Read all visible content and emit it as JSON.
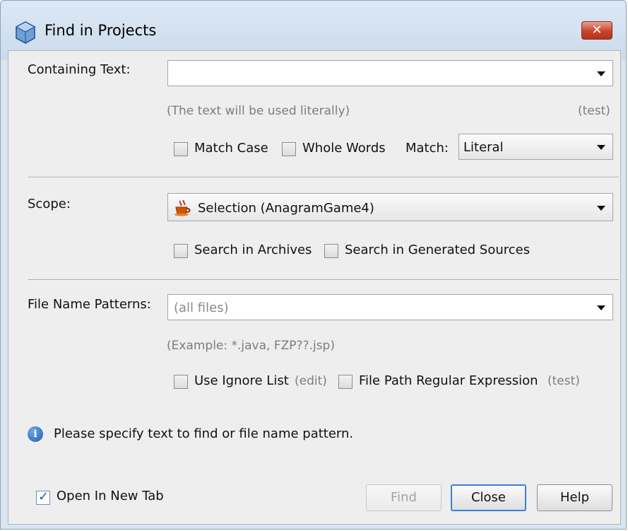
{
  "window": {
    "title": "Find in Projects",
    "close_glyph": "✕"
  },
  "containing_text": {
    "label": "Containing Text:",
    "value": "",
    "hint": "(The text will be used literally)",
    "test_link": "(test)",
    "match_case": {
      "label": "Match Case",
      "checked": false
    },
    "whole_words": {
      "label": "Whole Words",
      "checked": false
    },
    "match_label": "Match:",
    "match_value": "Literal"
  },
  "scope": {
    "label": "Scope:",
    "value": "Selection (AnagramGame4)",
    "icon": "coffee-cup-icon",
    "search_archives": {
      "label": "Search in Archives",
      "checked": false
    },
    "search_generated": {
      "label": "Search in Generated Sources",
      "checked": false
    }
  },
  "file_patterns": {
    "label": "File Name Patterns:",
    "placeholder": "(all files)",
    "example": "(Example: *.java, FZP??.jsp)",
    "ignore_list": {
      "label": "Use Ignore List",
      "checked": false,
      "link": "(edit)"
    },
    "regex": {
      "label": "File Path Regular Expression",
      "checked": false,
      "link": "(test)"
    }
  },
  "status": {
    "icon": "info-icon",
    "message": "Please specify text to find or file name pattern."
  },
  "footer": {
    "open_new_tab": {
      "label": "Open In New Tab",
      "checked": true
    },
    "find_button": "Find",
    "close_button": "Close",
    "help_button": "Help"
  },
  "colors": {
    "title_bar": "#cbdbec",
    "client_bg": "#eeeeee",
    "close_red": "#c9442a",
    "default_button_border": "#3c7fd1",
    "info_blue": "#1d5db4"
  }
}
